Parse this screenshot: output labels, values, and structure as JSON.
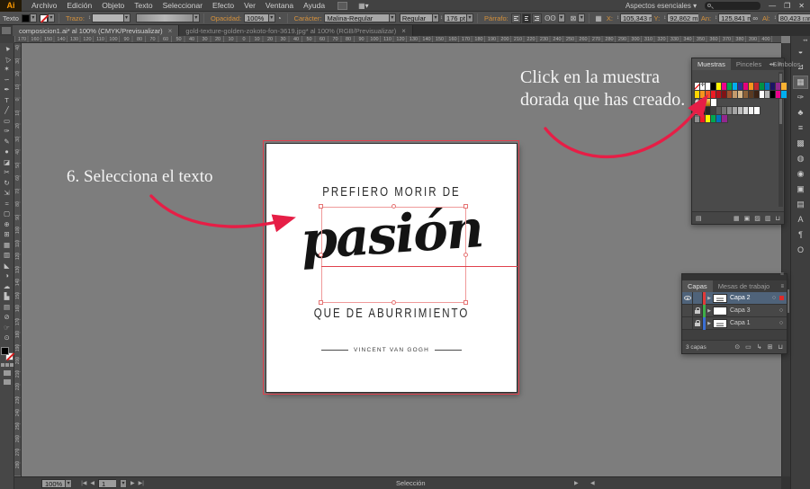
{
  "icons": {
    "dropdown": "▾",
    "stepper": "↕",
    "panel_collapse": "◂◂",
    "panel_menu": "≡",
    "controlbar_end": "»",
    "link_wh": "∞",
    "glasses": "ʘʘ",
    "no_style": "⊠",
    "ref_point": "▦",
    "style_circle": "◔",
    "layer_triangle": "▶",
    "layer_target": "○",
    "arrange": "▦▾"
  },
  "menubar": {
    "logo": "Ai",
    "menus": [
      "Archivo",
      "Edición",
      "Objeto",
      "Texto",
      "Seleccionar",
      "Efecto",
      "Ver",
      "Ventana",
      "Ayuda"
    ],
    "workspace": "Aspectos esenciales",
    "workspace_caret": "▾",
    "minimize": "—",
    "restore": "❐",
    "close": "✕"
  },
  "controlbar": {
    "object_label": "Texto",
    "stroke_label": "Trazo:",
    "opacity_label": "Opacidad:",
    "opacity_value": "100%",
    "character_label": "Carácter:",
    "font_name": "Malina-Regular",
    "font_style": "Regular",
    "font_size": "176 pt",
    "paragraph_label": "Párrafo:",
    "x_label": "X:",
    "x_value": "105,343 mm",
    "y_label": "Y:",
    "y_value": "92,862 mm",
    "w_label": "An:",
    "w_value": "125,841 mm",
    "h_label": "Al:",
    "h_value": "80,423 mm"
  },
  "tabbar": {
    "tabs": [
      {
        "label": "composicion1.ai* al 100% (CMYK/Previsualizar)",
        "close": "×",
        "active": true
      },
      {
        "label": "gold-texture-golden-zokoto-fon-3619.jpg* al 100% (RGB/Previsualizar)",
        "close": "×",
        "active": false
      }
    ]
  },
  "toolbar": {
    "tools": [
      {
        "name": "selection-tool",
        "glyph": "▲",
        "rot": -38
      },
      {
        "name": "direct-selection-tool",
        "glyph": "△",
        "rot": -38
      },
      {
        "name": "magic-wand-tool",
        "glyph": "✶"
      },
      {
        "name": "lasso-tool",
        "glyph": "∽"
      },
      {
        "name": "pen-tool",
        "glyph": "✒"
      },
      {
        "name": "type-tool",
        "glyph": "T"
      },
      {
        "name": "line-tool",
        "glyph": "╱"
      },
      {
        "name": "rectangle-tool",
        "glyph": "▭"
      },
      {
        "name": "paintbrush-tool",
        "glyph": "✑"
      },
      {
        "name": "pencil-tool",
        "glyph": "✎"
      },
      {
        "name": "blob-brush-tool",
        "glyph": "●"
      },
      {
        "name": "eraser-tool",
        "glyph": "◪"
      },
      {
        "name": "scissors-tool",
        "glyph": "✂"
      },
      {
        "name": "rotate-tool",
        "glyph": "↻"
      },
      {
        "name": "scale-tool",
        "glyph": "⇲"
      },
      {
        "name": "width-tool",
        "glyph": "≈"
      },
      {
        "name": "free-transform-tool",
        "glyph": "▢"
      },
      {
        "name": "shape-builder-tool",
        "glyph": "⊕"
      },
      {
        "name": "perspective-grid-tool",
        "glyph": "⊞"
      },
      {
        "name": "mesh-tool",
        "glyph": "▦"
      },
      {
        "name": "gradient-tool",
        "glyph": "▥"
      },
      {
        "name": "eyedropper-tool",
        "glyph": "◣"
      },
      {
        "name": "blend-tool",
        "glyph": "◑"
      },
      {
        "name": "symbol-sprayer-tool",
        "glyph": "☁"
      },
      {
        "name": "column-graph-tool",
        "glyph": "▙"
      },
      {
        "name": "artboard-tool",
        "glyph": "▤"
      },
      {
        "name": "slice-tool",
        "glyph": "⊘"
      },
      {
        "name": "hand-tool",
        "glyph": "☞"
      },
      {
        "name": "zoom-tool",
        "glyph": "⊙"
      }
    ]
  },
  "rulers": {
    "h": {
      "origin": 271,
      "spacing": 14.5,
      "step": 10,
      "from": 20,
      "to": 864
    },
    "v": {
      "origin": 111,
      "spacing": 14.5,
      "step": 10,
      "from": 52,
      "to": 526
    }
  },
  "poster": {
    "line1": "PREFIERO MORIR DE",
    "word": "pasión",
    "line2": "QUE DE ABURRIMIENTO",
    "author": "VINCENT VAN GOGH"
  },
  "annotations": {
    "step": "6. Selecciona el texto",
    "swatch_line1": "Click en la muestra",
    "swatch_line2": "dorada que has creado."
  },
  "swatches_panel": {
    "tabs": [
      "Muestras",
      "Pinceles",
      "Símbolos"
    ],
    "rows": [
      [
        "@none",
        "@reg",
        "#ffffff",
        "#000000",
        "#fff200",
        "#ec008c",
        "#00a651",
        "#00aeef",
        "#2e3192",
        "#e5007d",
        "#f7941d",
        "#c1272d",
        "#009245",
        "#0072bc",
        "#1b1464",
        "#93278f",
        "#f9b233"
      ],
      [
        "#ffd400",
        "#f7941d",
        "#f15a24",
        "#ed1c24",
        "#b4121b",
        "#7f1416",
        "#a0522d",
        "#c49a6c",
        "#d9b98c",
        "#8c6239",
        "#5a3a22",
        "#3d2314",
        "#ffffff",
        "#b3b3b3",
        "#000000",
        "#ec008c",
        "#00aeef"
      ],
      [
        "@gradbw",
        "@pattern",
        "@gold",
        "#ffffff"
      ],
      [
        "@group",
        "#000000",
        "#262626",
        "#404040",
        "#595959",
        "#737373",
        "#8c8c8c",
        "#a6a6a6",
        "#bfbfbf",
        "#d9d9d9",
        "#f2f2f2",
        "#ffffff"
      ],
      [
        "@group",
        "#ed1c24",
        "#fff200",
        "#00a651",
        "#0072bc",
        "#92278f"
      ]
    ],
    "footer": [
      {
        "name": "swatch-libraries-icon",
        "glyph": "▤"
      },
      {
        "name": "swatch-kinds-icon",
        "glyph": "▦"
      },
      {
        "name": "swatch-options-icon",
        "glyph": "▣"
      },
      {
        "name": "new-color-group-icon",
        "glyph": "▨"
      },
      {
        "name": "new-swatch-icon",
        "glyph": "▥"
      },
      {
        "name": "delete-swatch-icon",
        "glyph": "⊔"
      }
    ]
  },
  "layers_panel": {
    "tabs": [
      "Capas",
      "Mesas de trabajo"
    ],
    "layers": [
      {
        "name": "Capa 2",
        "color": "#e03a3a",
        "eye": true,
        "lock": false,
        "selected": true,
        "thumb": "mark"
      },
      {
        "name": "Capa 3",
        "color": "#3fae49",
        "eye": false,
        "lock": true,
        "selected": false,
        "thumb": "plain"
      },
      {
        "name": "Capa 1",
        "color": "#3b6fd4",
        "eye": false,
        "lock": true,
        "selected": false,
        "thumb": "mark"
      }
    ],
    "count": "3 capas",
    "footer": [
      {
        "name": "locate-object-icon",
        "glyph": "⊙"
      },
      {
        "name": "clipping-mask-icon",
        "glyph": "▭"
      },
      {
        "name": "new-sublayer-icon",
        "glyph": "↳"
      },
      {
        "name": "new-layer-icon",
        "glyph": "⊞"
      },
      {
        "name": "delete-layer-icon",
        "glyph": "⊔"
      }
    ]
  },
  "dock": {
    "icons": [
      {
        "name": "color-panel-icon",
        "glyph": "◒"
      },
      {
        "name": "color-guide-panel-icon",
        "glyph": "⊿"
      },
      {
        "name": "swatches-panel-icon",
        "glyph": "▦",
        "active": true
      },
      {
        "name": "brushes-panel-icon",
        "glyph": "✑"
      },
      {
        "name": "symbols-panel-icon",
        "glyph": "♣"
      },
      {
        "name": "stroke-panel-icon",
        "glyph": "≡"
      },
      {
        "name": "gradient-panel-icon",
        "glyph": "▩"
      },
      {
        "name": "transparency-panel-icon",
        "glyph": "◍"
      },
      {
        "name": "appearance-panel-icon",
        "glyph": "◉"
      },
      {
        "name": "graphic-styles-panel-icon",
        "glyph": "▣"
      },
      {
        "name": "layers-panel-icon",
        "glyph": "▤"
      },
      {
        "name": "character-panel-icon",
        "glyph": "A"
      },
      {
        "name": "paragraph-panel-icon",
        "glyph": "¶"
      },
      {
        "name": "opentype-panel-icon",
        "glyph": "O"
      }
    ]
  },
  "statusbar": {
    "zoom": "100%",
    "nav_first": "|◀",
    "nav_prev": "◀",
    "artboard": "1",
    "nav_next": "▶",
    "nav_last": "▶|",
    "status": "Selección",
    "scroll_right": "▶",
    "scroll_left": "◀"
  },
  "colors": {
    "accent_red": "#e61e46",
    "artboard_outline_red": "#e0404d",
    "selection_pink": "#ef9a9a",
    "gold_swatch": "#d79a1e"
  }
}
